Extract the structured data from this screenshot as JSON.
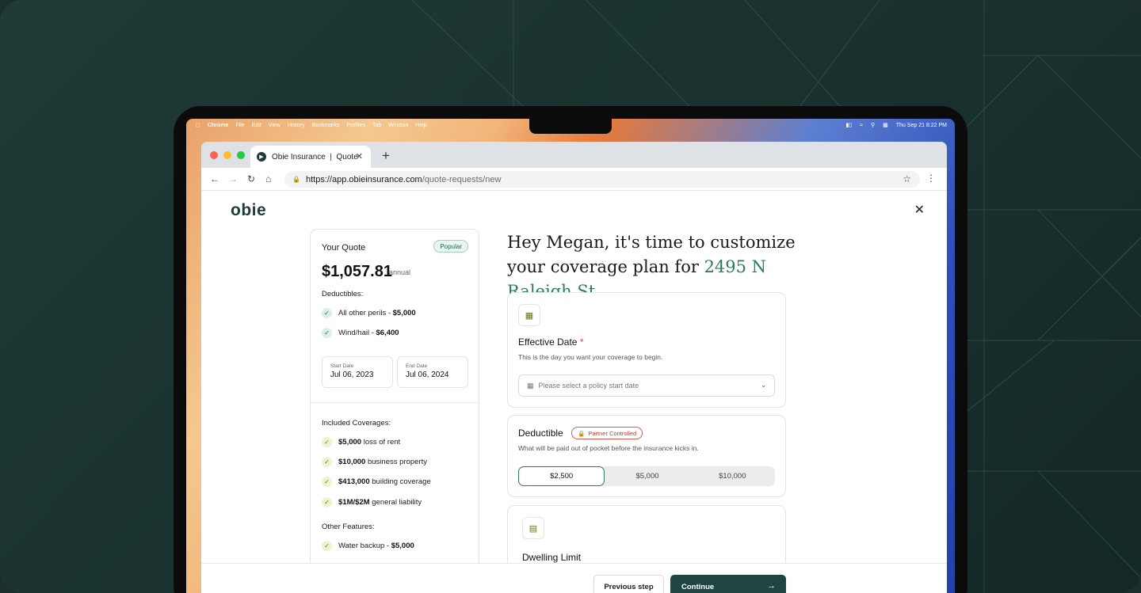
{
  "colors": {
    "brand": "#1f4540",
    "accent": "#2d7a5f",
    "danger": "#c0392b",
    "lime": "#5a7a10"
  },
  "mac_menubar": {
    "apple_icon": "apple-icon",
    "items": [
      "Chrome",
      "File",
      "Edit",
      "View",
      "History",
      "Bookmarks",
      "Profiles",
      "Tab",
      "Window",
      "Help"
    ],
    "datetime": "Thu Sep 21  8:22 PM"
  },
  "browser": {
    "tab_title": "Obie Insurance  |  Quote",
    "url_host": "https://app.obieinsurance.com",
    "url_path": "/quote-requests/new"
  },
  "app": {
    "logo": "obie"
  },
  "quote": {
    "title": "Your Quote",
    "badge": "Popular",
    "price": "$1,057.81",
    "price_unit": "annual",
    "deductibles_label": "Deductibles:",
    "deductibles": [
      {
        "label": "All other perils - ",
        "value": "$5,000"
      },
      {
        "label": "Wind/hail - ",
        "value": "$6,400"
      }
    ],
    "start_date_label": "Start Date",
    "start_date": "Jul 06, 2023",
    "end_date_label": "End Date",
    "end_date": "Jul 06, 2024",
    "coverages_label": "Included Coverages:",
    "coverages": [
      {
        "value": "$5,000",
        "label": " loss of rent"
      },
      {
        "value": "$10,000",
        "label": " business property"
      },
      {
        "value": "$413,000",
        "label": " building coverage"
      },
      {
        "value": "$1M/$2M",
        "label": " general liability"
      }
    ],
    "features_label": "Other Features:",
    "features": [
      {
        "label": "Water backup - ",
        "value": "$5,000"
      }
    ]
  },
  "main": {
    "headline": "Hey Megan, it's time to customize your coverage plan for ",
    "address": "2495 N Raleigh St.",
    "effective_date": {
      "title": "Effective Date",
      "required_mark": "*",
      "subtitle": "This is the day you want your coverage to begin.",
      "placeholder": "Please select a policy start date"
    },
    "deductible": {
      "title": "Deductible",
      "badge": "Partner Controlled",
      "subtitle": "What will be paid out of pocket before the insurance kicks in.",
      "options": [
        "$2,500",
        "$5,000",
        "$10,000"
      ],
      "selected": "$2,500"
    },
    "dwelling": {
      "title": "Dwelling Limit"
    }
  },
  "footer": {
    "previous": "Previous step",
    "continue": "Continue"
  }
}
